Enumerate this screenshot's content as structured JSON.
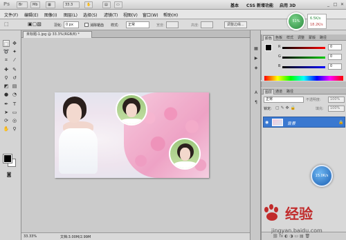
{
  "app": {
    "logo": "Ps",
    "zoom_dropdown": "33.3",
    "workspaces": [
      "基本",
      "CSS 新增功能",
      "启用 3D"
    ]
  },
  "menu": [
    "文件(F)",
    "编辑(E)",
    "图像(I)",
    "图层(L)",
    "选择(S)",
    "滤镜(T)",
    "视图(V)",
    "窗口(W)",
    "帮助(H)"
  ],
  "options": {
    "feather_label": "羽化:",
    "feather_value": "0 px",
    "antialias_label": "消除锯齿",
    "style_label": "样式:",
    "style_value": "正常",
    "width_label": "宽度:",
    "height_label": "高度:",
    "refine_edge": "调整边缘..."
  },
  "document": {
    "tab_title": "未标题-1.jpg @ 33.3%(RGB/8) *",
    "zoom": "33.33%",
    "doc_info": "文档:3.00M/2.99M"
  },
  "color_panel": {
    "tabs": [
      "颜色",
      "色板",
      "样式",
      "调整",
      "蒙版",
      "路径"
    ],
    "channels": [
      {
        "label": "R",
        "value": "0",
        "color": "#e04040"
      },
      {
        "label": "G",
        "value": "0",
        "color": "#40b040"
      },
      {
        "label": "B",
        "value": "0",
        "color": "#4060e0"
      }
    ]
  },
  "layers_panel": {
    "tabs": [
      "图层",
      "通道",
      "路径"
    ],
    "blend_mode": "正常",
    "opacity_label": "不透明度:",
    "opacity_value": "100%",
    "lock_label": "锁定:",
    "fill_label": "填充:",
    "fill_value": "100%",
    "layer_name": "背景"
  },
  "overlays": {
    "perf_percent": "51%",
    "net_up": "6.5K/s",
    "net_down": "18.2K/s",
    "mem_ball": "15.0K/s"
  },
  "watermark": {
    "text": "经验",
    "url": "jingyan.baidu.com"
  },
  "colors": {
    "selected_layer": "#3a78d0",
    "accent_red": "#c12b2b"
  }
}
